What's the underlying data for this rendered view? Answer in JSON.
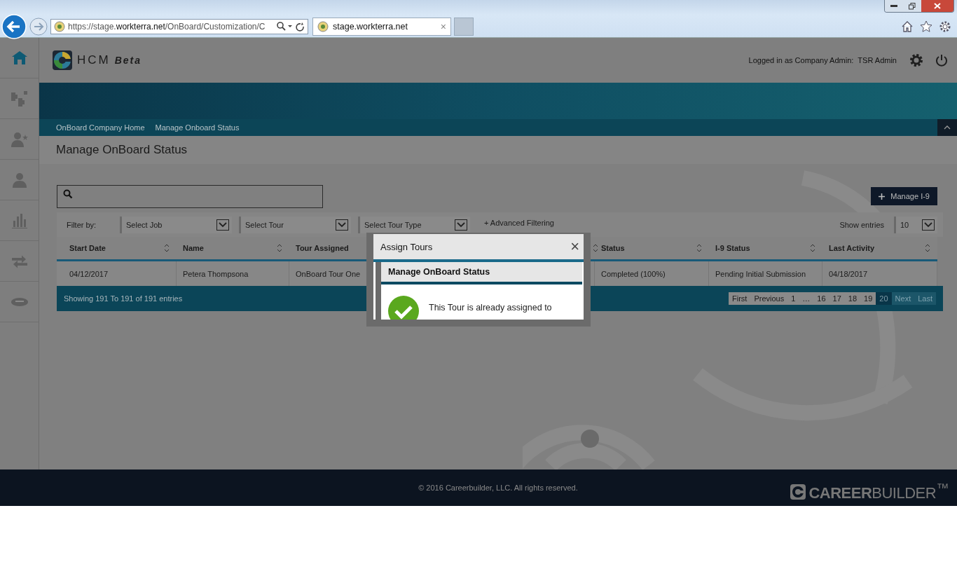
{
  "browser": {
    "url_prefix": "https://stage.",
    "url_domain": "workterra.net",
    "url_rest": "/OnBoard/Customization/C",
    "tab": {
      "title": "stage.workterra.net",
      "close": "×",
      "selected": true
    }
  },
  "header": {
    "logo": "HCM",
    "logo_suffix": "Beta",
    "logged_in_label": "Logged in as Company Admin:",
    "user": "TSR Admin"
  },
  "sidebar": {
    "items": [
      {
        "selected": true
      },
      {
        "selected": false
      },
      {
        "selected": false
      },
      {
        "selected": false
      },
      {
        "selected": false
      },
      {
        "selected": false
      },
      {
        "selected": false
      }
    ]
  },
  "breadcrumbs": [
    "OnBoard Company Home",
    "Manage Onboard Status"
  ],
  "page_title": "Manage OnBoard Status",
  "manage_i9_button": "Manage I-9",
  "filters": {
    "label": "Filter by:",
    "dropdowns": [
      {
        "placeholder": "Select Job"
      },
      {
        "placeholder": "Select Tour"
      },
      {
        "placeholder": "Select Tour Type"
      }
    ],
    "advanced": "+ Advanced Filtering",
    "show_entries_label": "Show entries",
    "show_entries_value": "10"
  },
  "table": {
    "columns": [
      {
        "label": "Start Date"
      },
      {
        "label": "Name"
      },
      {
        "label": "Tour Assigned"
      },
      {
        "label": "Status"
      },
      {
        "label": "I-9 Status"
      },
      {
        "label": "Last Activity"
      }
    ],
    "rows": [
      [
        "04/12/2017",
        "Petera Thompsona",
        "OnBoard Tour One",
        "Completed (100%)",
        "Pending Initial Submission",
        "04/18/2017"
      ]
    ],
    "summary": "Showing 191 To 191 of 191 entries",
    "pagination": [
      {
        "label": "First",
        "selected": false,
        "disabled": false
      },
      {
        "label": "Previous",
        "selected": false,
        "disabled": false
      },
      {
        "label": "1",
        "selected": false,
        "disabled": false
      },
      {
        "label": "…",
        "selected": false,
        "disabled": false
      },
      {
        "label": "16",
        "selected": false,
        "disabled": false
      },
      {
        "label": "17",
        "selected": false,
        "disabled": false
      },
      {
        "label": "18",
        "selected": false,
        "disabled": false
      },
      {
        "label": "19",
        "selected": false,
        "disabled": false
      },
      {
        "label": "20",
        "selected": true,
        "disabled": false
      },
      {
        "label": "Next",
        "selected": false,
        "disabled": true
      },
      {
        "label": "Last",
        "selected": false,
        "disabled": true
      }
    ]
  },
  "dialog": {
    "title": "Assign Tours",
    "close": "×",
    "inner_title": "Manage OnBoard Status",
    "message": "This Tour is already assigned to"
  },
  "footer": {
    "copyright": "© 2016 Careerbuilder, LLC. All rights reserved.",
    "brand": "**CAREER**BUILDER$^{™}$"
  }
}
